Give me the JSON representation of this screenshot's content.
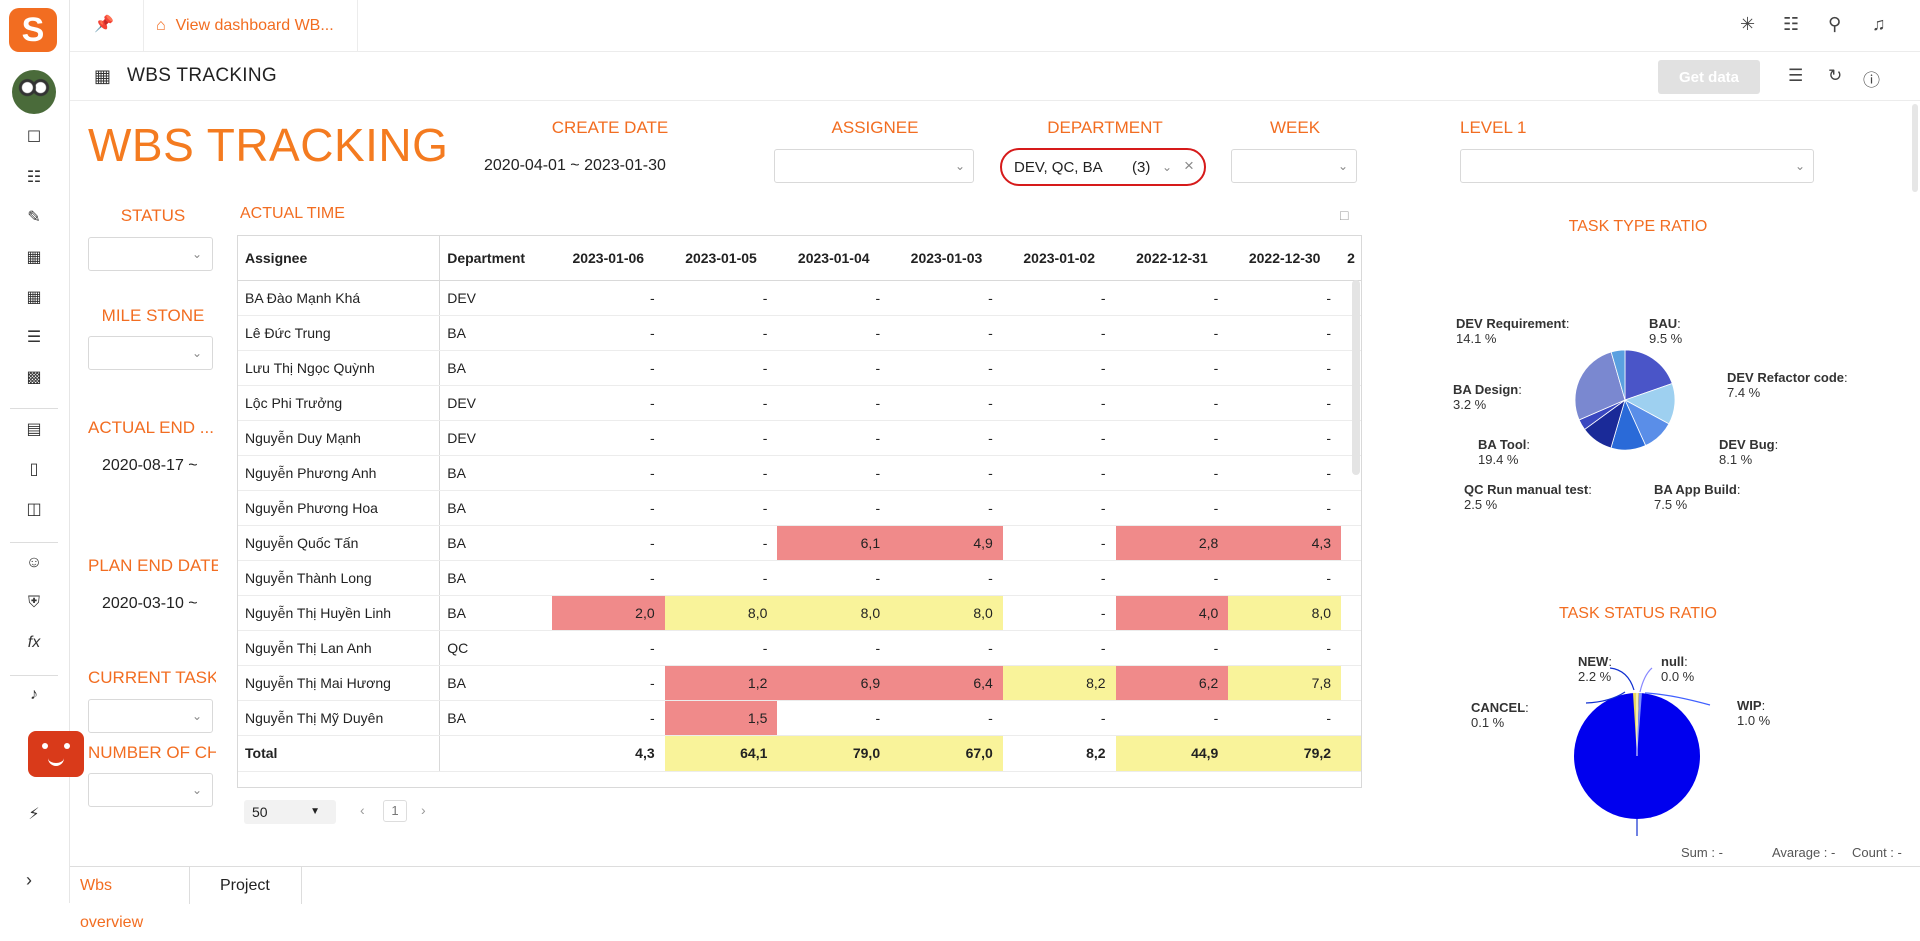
{
  "app": {
    "logo_letter": "S",
    "tab_title": "View dashboard WB...",
    "page_title": "WBS TRACKING",
    "get_data_label": "Get data"
  },
  "dashboard": {
    "big_title": "WBS TRACKING",
    "filters": {
      "create_date": {
        "label": "CREATE DATE",
        "value": "2020-04-01 ~ 2023-01-30"
      },
      "assignee": {
        "label": "ASSIGNEE",
        "value": ""
      },
      "department": {
        "label": "DEPARTMENT",
        "value": "DEV, QC, BA",
        "count": "(3)"
      },
      "week": {
        "label": "WEEK",
        "value": ""
      },
      "level1": {
        "label": "LEVEL 1",
        "value": ""
      }
    },
    "left_filters": {
      "status": "STATUS",
      "milestone": "MILE STONE",
      "actual_end": {
        "label": "ACTUAL END ...",
        "value": "2020-08-17 ~"
      },
      "plan_end": {
        "label": "PLAN END DATE",
        "value": "2020-03-10 ~"
      },
      "current_task": "CURRENT TASK...",
      "number_of_ch": "NUMBER OF CH..."
    }
  },
  "actual_time": {
    "label": "ACTUAL TIME",
    "headers": [
      "Assignee",
      "Department",
      "2023-01-06",
      "2023-01-05",
      "2023-01-04",
      "2023-01-03",
      "2023-01-02",
      "2022-12-31",
      "2022-12-30",
      "2"
    ],
    "rows": [
      {
        "name": "BA Đào Mạnh Khá",
        "dept": "DEV",
        "v": [
          "-",
          "-",
          "-",
          "-",
          "-",
          "-",
          "-"
        ],
        "c": [
          "",
          "",
          "",
          "",
          "",
          "",
          ""
        ]
      },
      {
        "name": "Lê Đức Trung",
        "dept": "BA",
        "v": [
          "-",
          "-",
          "-",
          "-",
          "-",
          "-",
          "-"
        ],
        "c": [
          "",
          "",
          "",
          "",
          "",
          "",
          ""
        ]
      },
      {
        "name": "Lưu Thị Ngọc Quỳnh",
        "dept": "BA",
        "v": [
          "-",
          "-",
          "-",
          "-",
          "-",
          "-",
          "-"
        ],
        "c": [
          "",
          "",
          "",
          "",
          "",
          "",
          ""
        ]
      },
      {
        "name": "Lộc Phi Trưởng",
        "dept": "DEV",
        "v": [
          "-",
          "-",
          "-",
          "-",
          "-",
          "-",
          "-"
        ],
        "c": [
          "",
          "",
          "",
          "",
          "",
          "",
          ""
        ]
      },
      {
        "name": "Nguyễn Duy Mạnh",
        "dept": "DEV",
        "v": [
          "-",
          "-",
          "-",
          "-",
          "-",
          "-",
          "-"
        ],
        "c": [
          "",
          "",
          "",
          "",
          "",
          "",
          ""
        ]
      },
      {
        "name": "Nguyễn Phương Anh",
        "dept": "BA",
        "v": [
          "-",
          "-",
          "-",
          "-",
          "-",
          "-",
          "-"
        ],
        "c": [
          "",
          "",
          "",
          "",
          "",
          "",
          ""
        ]
      },
      {
        "name": "Nguyễn Phương Hoa",
        "dept": "BA",
        "v": [
          "-",
          "-",
          "-",
          "-",
          "-",
          "-",
          "-"
        ],
        "c": [
          "",
          "",
          "",
          "",
          "",
          "",
          ""
        ]
      },
      {
        "name": "Nguyễn Quốc Tấn",
        "dept": "BA",
        "v": [
          "-",
          "-",
          "6,1",
          "4,9",
          "-",
          "2,8",
          "4,3"
        ],
        "c": [
          "",
          "",
          "red",
          "red",
          "",
          "red",
          "red"
        ]
      },
      {
        "name": "Nguyễn Thành Long",
        "dept": "BA",
        "v": [
          "-",
          "-",
          "-",
          "-",
          "-",
          "-",
          "-"
        ],
        "c": [
          "",
          "",
          "",
          "",
          "",
          "",
          ""
        ]
      },
      {
        "name": "Nguyễn Thị Huyền Linh",
        "dept": "BA",
        "v": [
          "2,0",
          "8,0",
          "8,0",
          "8,0",
          "-",
          "4,0",
          "8,0"
        ],
        "c": [
          "red",
          "yel",
          "yel",
          "yel",
          "",
          "red",
          "yel"
        ]
      },
      {
        "name": "Nguyễn Thị Lan Anh",
        "dept": "QC",
        "v": [
          "-",
          "-",
          "-",
          "-",
          "-",
          "-",
          "-"
        ],
        "c": [
          "",
          "",
          "",
          "",
          "",
          "",
          ""
        ]
      },
      {
        "name": "Nguyễn Thị Mai Hương",
        "dept": "BA",
        "v": [
          "-",
          "1,2",
          "6,9",
          "6,4",
          "8,2",
          "6,2",
          "7,8"
        ],
        "c": [
          "",
          "red",
          "red",
          "red",
          "yel",
          "red",
          "yel"
        ]
      },
      {
        "name": "Nguyễn Thị Mỹ Duyên",
        "dept": "BA",
        "v": [
          "-",
          "1,5",
          "-",
          "-",
          "-",
          "-",
          "-"
        ],
        "c": [
          "",
          "red",
          "",
          "",
          "",
          "",
          ""
        ]
      }
    ],
    "total": {
      "label": "Total",
      "v": [
        "4,3",
        "64,1",
        "79,0",
        "67,0",
        "8,2",
        "44,9",
        "79,2"
      ],
      "c": [
        "",
        "yel",
        "yel",
        "yel",
        "",
        "yel",
        "yel"
      ]
    },
    "page_size": "50",
    "page_num": "1"
  },
  "colors": {
    "red": "#f08a8a",
    "yel": "#f9f39a",
    "accent": "#f26d21"
  },
  "task_type_ratio": {
    "title": "TASK TYPE RATIO",
    "slices": [
      {
        "name": "DEV Requirement",
        "pct": "14.1 %",
        "value": 14.1,
        "color": "#4a55c8"
      },
      {
        "name": "BAU",
        "pct": "9.5 %",
        "value": 9.5,
        "color": "#9ed0f0"
      },
      {
        "name": "DEV Refactor code",
        "pct": "7.4 %",
        "value": 7.4,
        "color": "#5a8ee8"
      },
      {
        "name": "DEV Bug",
        "pct": "8.1 %",
        "value": 8.1,
        "color": "#2a6ad8"
      },
      {
        "name": "BA App Build",
        "pct": "7.5 %",
        "value": 7.5,
        "color": "#1a2a98"
      },
      {
        "name": "QC Run manual test",
        "pct": "2.5 %",
        "value": 2.5,
        "color": "#3a48c0"
      },
      {
        "name": "BA Tool",
        "pct": "19.4 %",
        "value": 19.4,
        "color": "#7a88d0"
      },
      {
        "name": "BA Design",
        "pct": "3.2 %",
        "value": 3.2,
        "color": "#5aa0e0"
      }
    ]
  },
  "task_status_ratio": {
    "title": "TASK STATUS RATIO",
    "slices": [
      {
        "name": "NEW",
        "pct": "2.2 %",
        "value": 2.2,
        "color": "#e8d860"
      },
      {
        "name": "null",
        "pct": "0.0 %",
        "value": 0.0,
        "color": "#8888ff"
      },
      {
        "name": "WIP",
        "pct": "1.0 %",
        "value": 1.0,
        "color": "#4060ff"
      },
      {
        "name": "CANCEL",
        "pct": "0.1 %",
        "value": 0.1,
        "color": "#1030d0"
      }
    ]
  },
  "footer": {
    "sum": "Sum : -",
    "average": "Avarage : -",
    "count": "Count : -"
  },
  "bottom_tabs": [
    "Wbs overview",
    "Project"
  ]
}
